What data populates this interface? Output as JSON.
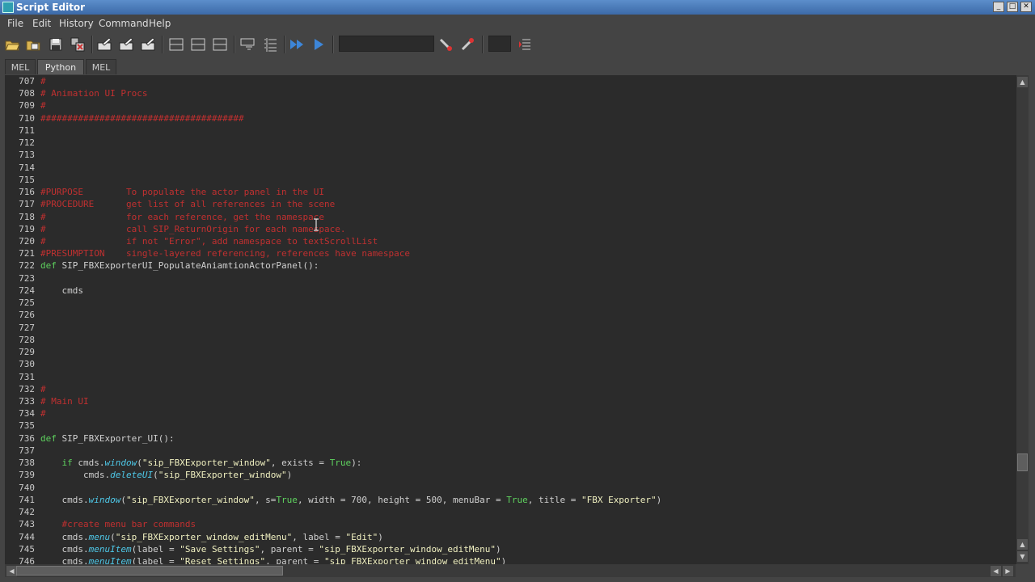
{
  "window": {
    "title": "Script Editor",
    "buttons": [
      "_",
      "□",
      "✕"
    ]
  },
  "menubar": [
    "File",
    "Edit",
    "History",
    "Command",
    "Help"
  ],
  "toolbar": {
    "icons": [
      "open-script-icon",
      "source-script-icon",
      "save-script-icon",
      "save-to-shelf-icon",
      "clear-history-icon",
      "clear-input-icon",
      "clear-all-icon",
      "show-history-icon",
      "show-input-icon",
      "show-both-icon",
      "echo-commands-icon",
      "line-numbers-icon",
      "execute-all-icon",
      "execute-icon",
      "search-next-icon",
      "search-prev-icon",
      "wrap-icon"
    ],
    "search_value": "",
    "small_value": ""
  },
  "tabs": [
    {
      "label": "MEL",
      "active": false
    },
    {
      "label": "Python",
      "active": true
    },
    {
      "label": "MEL",
      "active": false
    }
  ],
  "editor": {
    "lines": [
      {
        "n": "707",
        "parts": [
          [
            "c",
            "#"
          ]
        ]
      },
      {
        "n": "708",
        "parts": [
          [
            "c",
            "# Animation UI Procs"
          ]
        ]
      },
      {
        "n": "709",
        "parts": [
          [
            "c",
            "#"
          ]
        ]
      },
      {
        "n": "710",
        "parts": [
          [
            "c",
            "######################################"
          ]
        ]
      },
      {
        "n": "711",
        "parts": []
      },
      {
        "n": "712",
        "parts": []
      },
      {
        "n": "713",
        "parts": []
      },
      {
        "n": "714",
        "parts": []
      },
      {
        "n": "715",
        "parts": []
      },
      {
        "n": "716",
        "parts": [
          [
            "c",
            "#PURPOSE        To populate the actor panel in the UI"
          ]
        ]
      },
      {
        "n": "717",
        "parts": [
          [
            "c",
            "#PROCEDURE      get list of all references in the scene"
          ]
        ]
      },
      {
        "n": "718",
        "parts": [
          [
            "c",
            "#               for each reference, get the namespace"
          ]
        ]
      },
      {
        "n": "719",
        "parts": [
          [
            "c",
            "#               call SIP_ReturnOrigin for each namespace."
          ]
        ]
      },
      {
        "n": "720",
        "parts": [
          [
            "c",
            "#               if not \"Error\", add namespace to textScrollList"
          ]
        ]
      },
      {
        "n": "721",
        "parts": [
          [
            "c",
            "#PRESUMPTION    single-layered referencing, references have namespace"
          ]
        ]
      },
      {
        "n": "722",
        "parts": [
          [
            "k",
            "def"
          ],
          [
            "t",
            " SIP_FBXExporterUI_PopulateAniamtionActorPanel():"
          ]
        ]
      },
      {
        "n": "723",
        "parts": []
      },
      {
        "n": "724",
        "parts": [
          [
            "t",
            "    cmds"
          ]
        ]
      },
      {
        "n": "725",
        "parts": []
      },
      {
        "n": "726",
        "parts": []
      },
      {
        "n": "727",
        "parts": []
      },
      {
        "n": "728",
        "parts": []
      },
      {
        "n": "729",
        "parts": []
      },
      {
        "n": "730",
        "parts": []
      },
      {
        "n": "731",
        "parts": []
      },
      {
        "n": "732",
        "parts": [
          [
            "c",
            "#"
          ]
        ]
      },
      {
        "n": "733",
        "parts": [
          [
            "c",
            "# Main UI"
          ]
        ]
      },
      {
        "n": "734",
        "parts": [
          [
            "c",
            "#"
          ]
        ]
      },
      {
        "n": "735",
        "parts": []
      },
      {
        "n": "736",
        "parts": [
          [
            "k",
            "def"
          ],
          [
            "t",
            " SIP_FBXExporter_UI():"
          ]
        ]
      },
      {
        "n": "737",
        "parts": []
      },
      {
        "n": "738",
        "parts": [
          [
            "t",
            "    "
          ],
          [
            "k",
            "if"
          ],
          [
            "t",
            " cmds."
          ],
          [
            "f",
            "window"
          ],
          [
            "t",
            "("
          ],
          [
            "s",
            "\"sip_FBXExporter_window\""
          ],
          [
            "t",
            ", exists = "
          ],
          [
            "k",
            "True"
          ],
          [
            "t",
            "):"
          ]
        ]
      },
      {
        "n": "739",
        "parts": [
          [
            "t",
            "        cmds."
          ],
          [
            "f",
            "deleteUI"
          ],
          [
            "t",
            "("
          ],
          [
            "s",
            "\"sip_FBXExporter_window\""
          ],
          [
            "t",
            ")"
          ]
        ]
      },
      {
        "n": "740",
        "parts": []
      },
      {
        "n": "741",
        "parts": [
          [
            "t",
            "    cmds."
          ],
          [
            "f",
            "window"
          ],
          [
            "t",
            "("
          ],
          [
            "s",
            "\"sip_FBXExporter_window\""
          ],
          [
            "t",
            ", s="
          ],
          [
            "k",
            "True"
          ],
          [
            "t",
            ", width = 700, height = 500, menuBar = "
          ],
          [
            "k",
            "True"
          ],
          [
            "t",
            ", title = "
          ],
          [
            "s",
            "\"FBX Exporter\""
          ],
          [
            "t",
            ")"
          ]
        ]
      },
      {
        "n": "742",
        "parts": []
      },
      {
        "n": "743",
        "parts": [
          [
            "t",
            "    "
          ],
          [
            "c",
            "#create menu bar commands"
          ]
        ]
      },
      {
        "n": "744",
        "parts": [
          [
            "t",
            "    cmds."
          ],
          [
            "f",
            "menu"
          ],
          [
            "t",
            "("
          ],
          [
            "s",
            "\"sip_FBXExporter_window_editMenu\""
          ],
          [
            "t",
            ", label = "
          ],
          [
            "s",
            "\"Edit\""
          ],
          [
            "t",
            ")"
          ]
        ]
      },
      {
        "n": "745",
        "parts": [
          [
            "t",
            "    cmds."
          ],
          [
            "f",
            "menuItem"
          ],
          [
            "t",
            "(label = "
          ],
          [
            "s",
            "\"Save Settings\""
          ],
          [
            "t",
            ", parent = "
          ],
          [
            "s",
            "\"sip_FBXExporter_window_editMenu\""
          ],
          [
            "t",
            ")"
          ]
        ]
      },
      {
        "n": "746",
        "parts": [
          [
            "t",
            "    cmds."
          ],
          [
            "f",
            "menuItem"
          ],
          [
            "t",
            "(label = "
          ],
          [
            "s",
            "\"Reset Settings\""
          ],
          [
            "t",
            ", parent = "
          ],
          [
            "s",
            "\"sip_FBXExporter_window_editMenu\""
          ],
          [
            "t",
            ")"
          ]
        ]
      }
    ]
  }
}
